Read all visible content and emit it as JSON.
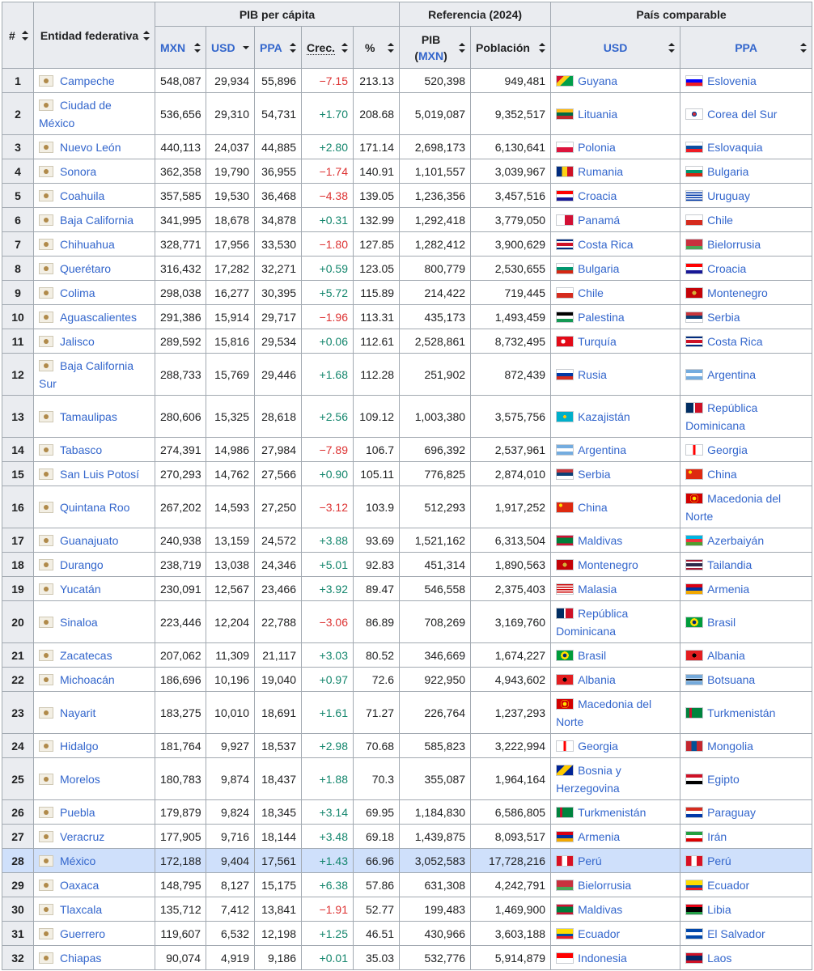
{
  "header": {
    "rank": "#",
    "entity": "Entidad federativa",
    "gdp_pc": "PIB per cápita",
    "ref": "Referencia (2024)",
    "comparable": "País comparable",
    "mxn": "MXN",
    "usd": "USD",
    "ppa": "PPA",
    "crec": "Crec.",
    "pct": "%",
    "pib": "PIB",
    "pib_unit": "MXN",
    "pop": "Población",
    "cmp_usd": "USD",
    "cmp_ppa": "PPA"
  },
  "colors": {
    "positive": "#14866d",
    "negative": "#d33333",
    "link": "#3366cc",
    "highlight": "#cfe0fb"
  },
  "rows": [
    {
      "rank": "1",
      "entity": "Campeche",
      "mxn": "548,087",
      "usd": "29,934",
      "ppa": "55,896",
      "crec": "−7.15",
      "pct": "213.13",
      "pib": "520,398",
      "pop": "949,481",
      "c_usd": "Guyana",
      "c_ppa": "Eslovenia",
      "f_usd": "guyana",
      "f_ppa": "slovenia"
    },
    {
      "rank": "2",
      "entity": "Ciudad de México",
      "mxn": "536,656",
      "usd": "29,310",
      "ppa": "54,731",
      "crec": "+1.70",
      "pct": "208.68",
      "pib": "5,019,087",
      "pop": "9,352,517",
      "c_usd": "Lituania",
      "c_ppa": "Corea del Sur",
      "f_usd": "lithuania",
      "f_ppa": "korea"
    },
    {
      "rank": "3",
      "entity": "Nuevo León",
      "mxn": "440,113",
      "usd": "24,037",
      "ppa": "44,885",
      "crec": "+2.80",
      "pct": "171.14",
      "pib": "2,698,173",
      "pop": "6,130,641",
      "c_usd": "Polonia",
      "c_ppa": "Eslovaquia",
      "f_usd": "poland",
      "f_ppa": "slovakia"
    },
    {
      "rank": "4",
      "entity": "Sonora",
      "mxn": "362,358",
      "usd": "19,790",
      "ppa": "36,955",
      "crec": "−1.74",
      "pct": "140.91",
      "pib": "1,101,557",
      "pop": "3,039,967",
      "c_usd": "Rumania",
      "c_ppa": "Bulgaria",
      "f_usd": "romania",
      "f_ppa": "bulgaria"
    },
    {
      "rank": "5",
      "entity": "Coahuila",
      "mxn": "357,585",
      "usd": "19,530",
      "ppa": "36,468",
      "crec": "−4.38",
      "pct": "139.05",
      "pib": "1,236,356",
      "pop": "3,457,516",
      "c_usd": "Croacia",
      "c_ppa": "Uruguay",
      "f_usd": "croatia",
      "f_ppa": "uruguay"
    },
    {
      "rank": "6",
      "entity": "Baja California",
      "mxn": "341,995",
      "usd": "18,678",
      "ppa": "34,878",
      "crec": "+0.31",
      "pct": "132.99",
      "pib": "1,292,418",
      "pop": "3,779,050",
      "c_usd": "Panamá",
      "c_ppa": "Chile",
      "f_usd": "panama",
      "f_ppa": "chile"
    },
    {
      "rank": "7",
      "entity": "Chihuahua",
      "mxn": "328,771",
      "usd": "17,956",
      "ppa": "33,530",
      "crec": "−1.80",
      "pct": "127.85",
      "pib": "1,282,412",
      "pop": "3,900,629",
      "c_usd": "Costa Rica",
      "c_ppa": "Bielorrusia",
      "f_usd": "costarica",
      "f_ppa": "belarus"
    },
    {
      "rank": "8",
      "entity": "Querétaro",
      "mxn": "316,432",
      "usd": "17,282",
      "ppa": "32,271",
      "crec": "+0.59",
      "pct": "123.05",
      "pib": "800,779",
      "pop": "2,530,655",
      "c_usd": "Bulgaria",
      "c_ppa": "Croacia",
      "f_usd": "bulgaria",
      "f_ppa": "croatia"
    },
    {
      "rank": "9",
      "entity": "Colima",
      "mxn": "298,038",
      "usd": "16,277",
      "ppa": "30,395",
      "crec": "+5.72",
      "pct": "115.89",
      "pib": "214,422",
      "pop": "719,445",
      "c_usd": "Chile",
      "c_ppa": "Montenegro",
      "f_usd": "chile",
      "f_ppa": "montenegro"
    },
    {
      "rank": "10",
      "entity": "Aguascalientes",
      "mxn": "291,386",
      "usd": "15,914",
      "ppa": "29,717",
      "crec": "−1.96",
      "pct": "113.31",
      "pib": "435,173",
      "pop": "1,493,459",
      "c_usd": "Palestina",
      "c_ppa": "Serbia",
      "f_usd": "palestine",
      "f_ppa": "serbia"
    },
    {
      "rank": "11",
      "entity": "Jalisco",
      "mxn": "289,592",
      "usd": "15,816",
      "ppa": "29,534",
      "crec": "+0.06",
      "pct": "112.61",
      "pib": "2,528,861",
      "pop": "8,732,495",
      "c_usd": "Turquía",
      "c_ppa": "Costa Rica",
      "f_usd": "turkey",
      "f_ppa": "costarica"
    },
    {
      "rank": "12",
      "entity": "Baja California Sur",
      "mxn": "288,733",
      "usd": "15,769",
      "ppa": "29,446",
      "crec": "+1.68",
      "pct": "112.28",
      "pib": "251,902",
      "pop": "872,439",
      "c_usd": "Rusia",
      "c_ppa": "Argentina",
      "f_usd": "russia",
      "f_ppa": "argentina"
    },
    {
      "rank": "13",
      "entity": "Tamaulipas",
      "mxn": "280,606",
      "usd": "15,325",
      "ppa": "28,618",
      "crec": "+2.56",
      "pct": "109.12",
      "pib": "1,003,380",
      "pop": "3,575,756",
      "c_usd": "Kazajistán",
      "c_ppa": "República Dominicana",
      "f_usd": "kazakhstan",
      "f_ppa": "dominican"
    },
    {
      "rank": "14",
      "entity": "Tabasco",
      "mxn": "274,391",
      "usd": "14,986",
      "ppa": "27,984",
      "crec": "−7.89",
      "pct": "106.7",
      "pib": "696,392",
      "pop": "2,537,961",
      "c_usd": "Argentina",
      "c_ppa": "Georgia",
      "f_usd": "argentina",
      "f_ppa": "georgia"
    },
    {
      "rank": "15",
      "entity": "San Luis Potosí",
      "mxn": "270,293",
      "usd": "14,762",
      "ppa": "27,566",
      "crec": "+0.90",
      "pct": "105.11",
      "pib": "776,825",
      "pop": "2,874,010",
      "c_usd": "Serbia",
      "c_ppa": "China",
      "f_usd": "serbia",
      "f_ppa": "china"
    },
    {
      "rank": "16",
      "entity": "Quintana Roo",
      "mxn": "267,202",
      "usd": "14,593",
      "ppa": "27,250",
      "crec": "−3.12",
      "pct": "103.9",
      "pib": "512,293",
      "pop": "1,917,252",
      "c_usd": "China",
      "c_ppa": "Macedonia del Norte",
      "f_usd": "china",
      "f_ppa": "macedonia"
    },
    {
      "rank": "17",
      "entity": "Guanajuato",
      "mxn": "240,938",
      "usd": "13,159",
      "ppa": "24,572",
      "crec": "+3.88",
      "pct": "93.69",
      "pib": "1,521,162",
      "pop": "6,313,504",
      "c_usd": "Maldivas",
      "c_ppa": "Azerbaiyán",
      "f_usd": "maldives",
      "f_ppa": "azerbaijan"
    },
    {
      "rank": "18",
      "entity": "Durango",
      "mxn": "238,719",
      "usd": "13,038",
      "ppa": "24,346",
      "crec": "+5.01",
      "pct": "92.83",
      "pib": "451,314",
      "pop": "1,890,563",
      "c_usd": "Montenegro",
      "c_ppa": "Tailandia",
      "f_usd": "montenegro",
      "f_ppa": "thailand"
    },
    {
      "rank": "19",
      "entity": "Yucatán",
      "mxn": "230,091",
      "usd": "12,567",
      "ppa": "23,466",
      "crec": "+3.92",
      "pct": "89.47",
      "pib": "546,558",
      "pop": "2,375,403",
      "c_usd": "Malasia",
      "c_ppa": "Armenia",
      "f_usd": "malaysia",
      "f_ppa": "armenia"
    },
    {
      "rank": "20",
      "entity": "Sinaloa",
      "mxn": "223,446",
      "usd": "12,204",
      "ppa": "22,788",
      "crec": "−3.06",
      "pct": "86.89",
      "pib": "708,269",
      "pop": "3,169,760",
      "c_usd": "República Dominicana",
      "c_ppa": "Brasil",
      "f_usd": "dominican",
      "f_ppa": "brazil"
    },
    {
      "rank": "21",
      "entity": "Zacatecas",
      "mxn": "207,062",
      "usd": "11,309",
      "ppa": "21,117",
      "crec": "+3.03",
      "pct": "80.52",
      "pib": "346,669",
      "pop": "1,674,227",
      "c_usd": "Brasil",
      "c_ppa": "Albania",
      "f_usd": "brazil",
      "f_ppa": "albania"
    },
    {
      "rank": "22",
      "entity": "Michoacán",
      "mxn": "186,696",
      "usd": "10,196",
      "ppa": "19,040",
      "crec": "+0.97",
      "pct": "72.6",
      "pib": "922,950",
      "pop": "4,943,602",
      "c_usd": "Albania",
      "c_ppa": "Botsuana",
      "f_usd": "albania",
      "f_ppa": "botswana"
    },
    {
      "rank": "23",
      "entity": "Nayarit",
      "mxn": "183,275",
      "usd": "10,010",
      "ppa": "18,691",
      "crec": "+1.61",
      "pct": "71.27",
      "pib": "226,764",
      "pop": "1,237,293",
      "c_usd": "Macedonia del Norte",
      "c_ppa": "Turkmenistán",
      "f_usd": "macedonia",
      "f_ppa": "turkmenistan"
    },
    {
      "rank": "24",
      "entity": "Hidalgo",
      "mxn": "181,764",
      "usd": "9,927",
      "ppa": "18,537",
      "crec": "+2.98",
      "pct": "70.68",
      "pib": "585,823",
      "pop": "3,222,994",
      "c_usd": "Georgia",
      "c_ppa": "Mongolia",
      "f_usd": "georgia",
      "f_ppa": "mongolia"
    },
    {
      "rank": "25",
      "entity": "Morelos",
      "mxn": "180,783",
      "usd": "9,874",
      "ppa": "18,437",
      "crec": "+1.88",
      "pct": "70.3",
      "pib": "355,087",
      "pop": "1,964,164",
      "c_usd": "Bosnia y Herzegovina",
      "c_ppa": "Egipto",
      "f_usd": "bosnia",
      "f_ppa": "egypt"
    },
    {
      "rank": "26",
      "entity": "Puebla",
      "mxn": "179,879",
      "usd": "9,824",
      "ppa": "18,345",
      "crec": "+3.14",
      "pct": "69.95",
      "pib": "1,184,830",
      "pop": "6,586,805",
      "c_usd": "Turkmenistán",
      "c_ppa": "Paraguay",
      "f_usd": "turkmenistan",
      "f_ppa": "paraguay"
    },
    {
      "rank": "27",
      "entity": "Veracruz",
      "mxn": "177,905",
      "usd": "9,716",
      "ppa": "18,144",
      "crec": "+3.48",
      "pct": "69.18",
      "pib": "1,439,875",
      "pop": "8,093,517",
      "c_usd": "Armenia",
      "c_ppa": "Irán",
      "f_usd": "armenia",
      "f_ppa": "iran"
    },
    {
      "rank": "28",
      "entity": "México",
      "mxn": "172,188",
      "usd": "9,404",
      "ppa": "17,561",
      "crec": "+1.43",
      "pct": "66.96",
      "pib": "3,052,583",
      "pop": "17,728,216",
      "c_usd": "Perú",
      "c_ppa": "Perú",
      "f_usd": "peru",
      "f_ppa": "peru",
      "highlight": true
    },
    {
      "rank": "29",
      "entity": "Oaxaca",
      "mxn": "148,795",
      "usd": "8,127",
      "ppa": "15,175",
      "crec": "+6.38",
      "pct": "57.86",
      "pib": "631,308",
      "pop": "4,242,791",
      "c_usd": "Bielorrusia",
      "c_ppa": "Ecuador",
      "f_usd": "belarus",
      "f_ppa": "ecuador"
    },
    {
      "rank": "30",
      "entity": "Tlaxcala",
      "mxn": "135,712",
      "usd": "7,412",
      "ppa": "13,841",
      "crec": "−1.91",
      "pct": "52.77",
      "pib": "199,483",
      "pop": "1,469,900",
      "c_usd": "Maldivas",
      "c_ppa": "Libia",
      "f_usd": "maldives",
      "f_ppa": "libya"
    },
    {
      "rank": "31",
      "entity": "Guerrero",
      "mxn": "119,607",
      "usd": "6,532",
      "ppa": "12,198",
      "crec": "+1.25",
      "pct": "46.51",
      "pib": "430,966",
      "pop": "3,603,188",
      "c_usd": "Ecuador",
      "c_ppa": "El Salvador",
      "f_usd": "ecuador",
      "f_ppa": "elsalvador"
    },
    {
      "rank": "32",
      "entity": "Chiapas",
      "mxn": "90,074",
      "usd": "4,919",
      "ppa": "9,186",
      "crec": "+0.01",
      "pct": "35.03",
      "pib": "532,776",
      "pop": "5,914,879",
      "c_usd": "Indonesia",
      "c_ppa": "Laos",
      "f_usd": "indonesia",
      "f_ppa": "laos"
    }
  ]
}
